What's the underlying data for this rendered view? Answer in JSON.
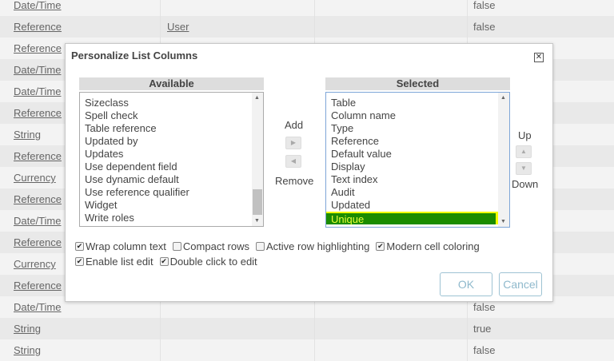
{
  "background_rows": [
    {
      "type": "Date/Time",
      "ref": "",
      "val": "false"
    },
    {
      "type": "Reference",
      "ref": "User",
      "val": "false"
    },
    {
      "type": "Reference",
      "ref": "",
      "val": ""
    },
    {
      "type": "Date/Time",
      "ref": "",
      "val": ""
    },
    {
      "type": "Date/Time",
      "ref": "",
      "val": ""
    },
    {
      "type": "Reference",
      "ref": "",
      "val": ""
    },
    {
      "type": "String",
      "ref": "",
      "val": ""
    },
    {
      "type": "Reference",
      "ref": "",
      "val": ""
    },
    {
      "type": "Currency",
      "ref": "",
      "val": ""
    },
    {
      "type": "Reference",
      "ref": "",
      "val": ""
    },
    {
      "type": "Date/Time",
      "ref": "",
      "val": ""
    },
    {
      "type": "Reference",
      "ref": "",
      "val": ""
    },
    {
      "type": "Currency",
      "ref": "",
      "val": ""
    },
    {
      "type": "Reference",
      "ref": "",
      "val": ""
    },
    {
      "type": "Date/Time",
      "ref": "",
      "val": "false"
    },
    {
      "type": "String",
      "ref": "",
      "val": "true"
    },
    {
      "type": "String",
      "ref": "",
      "val": "false"
    }
  ],
  "dialog": {
    "title": "Personalize List Columns",
    "close_icon": "close-icon",
    "available_header": "Available",
    "available_items": [
      "Sizeclass",
      "Spell check",
      "Table reference",
      "Updated by",
      "Updates",
      "Use dependent field",
      "Use dynamic default",
      "Use reference qualifier",
      "Widget",
      "Write roles"
    ],
    "selected_header": "Selected",
    "selected_items": [
      "Table",
      "Column name",
      "Type",
      "Reference",
      "Default value",
      "Display",
      "Text index",
      "Audit",
      "Updated",
      "Unique"
    ],
    "highlight_color": "#1a8c00",
    "add_label": "Add",
    "remove_label": "Remove",
    "up_label": "Up",
    "down_label": "Down",
    "options": [
      {
        "label": "Wrap column text",
        "checked": true
      },
      {
        "label": "Compact rows",
        "checked": false
      },
      {
        "label": "Active row highlighting",
        "checked": false
      },
      {
        "label": "Modern cell coloring",
        "checked": true
      },
      {
        "label": "Enable list edit",
        "checked": true
      },
      {
        "label": "Double click to edit",
        "checked": true
      }
    ],
    "ok_label": "OK",
    "cancel_label": "Cancel"
  }
}
